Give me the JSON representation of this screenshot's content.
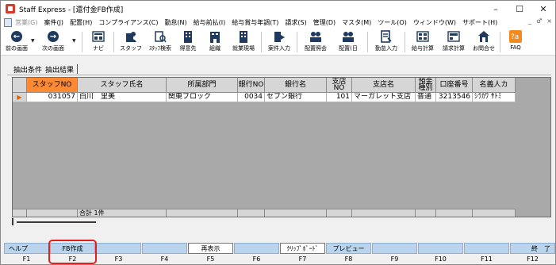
{
  "window": {
    "title": "Staff Express - [還付金FB作成]",
    "controls": [
      "–",
      "☐",
      "✕"
    ],
    "mdi_controls": [
      "_",
      "♂",
      "×"
    ]
  },
  "menu": [
    {
      "label": "営業(G)",
      "disabled": true
    },
    {
      "label": "案件(J)",
      "disabled": false
    },
    {
      "label": "配置(H)",
      "disabled": false
    },
    {
      "label": "コンプライアンス(C)",
      "disabled": false
    },
    {
      "label": "勤怠(N)",
      "disabled": false
    },
    {
      "label": "給与前払(I)",
      "disabled": false
    },
    {
      "label": "給与賞与年調(T)",
      "disabled": false
    },
    {
      "label": "請求(S)",
      "disabled": false
    },
    {
      "label": "管理(D)",
      "disabled": false
    },
    {
      "label": "マスタ(M)",
      "disabled": false
    },
    {
      "label": "ツール(O)",
      "disabled": false
    },
    {
      "label": "ウィンドウ(W)",
      "disabled": false
    },
    {
      "label": "サポート(H)",
      "disabled": false
    }
  ],
  "toolbar": {
    "back": "前の画面",
    "forward": "次の画面",
    "navi": "ナビ",
    "staff": "スタッフ",
    "staff_search": "ｽﾀｯﾌ検索",
    "client": "得意先",
    "org": "組織",
    "site": "就業現場",
    "job_input": "案件入力",
    "assign_inquiry": "配置照会",
    "assign_day": "配置(日",
    "attendance_input": "勤怠入力",
    "payroll_calc": "給与計算",
    "billing_calc": "請求計算",
    "contact": "お問合せ",
    "faq": "FAQ"
  },
  "tabs": {
    "conditions": "抽出条件",
    "results": "抽出結果"
  },
  "grid": {
    "headers": {
      "staff_no": "スタッフNO",
      "staff_name": "スタッフ氏名",
      "dept": "所属部門",
      "bank_no": "銀行NO",
      "bank_name": "銀行名",
      "branch_no": "支店NO",
      "branch_name": "支店名",
      "deposit_type": "預金種別",
      "account_no": "口座番号",
      "holder_name": "名義人カ"
    },
    "row": {
      "staff_no": "031057",
      "staff_name": "白川　里美",
      "dept": "関東ブロック",
      "bank_no": "0034",
      "bank_name": "セブン銀行",
      "branch_no": "101",
      "branch_name": "マーガレット支店",
      "deposit_type": "普通",
      "account_no": "3213546",
      "holder_name": "ｼﾗｶﾜ ｻﾄﾐ"
    },
    "total": "合計 1件"
  },
  "fkeys": [
    {
      "key": "F1",
      "label": "ヘルプ"
    },
    {
      "key": "F2",
      "label": "FB作成"
    },
    {
      "key": "F3",
      "label": ""
    },
    {
      "key": "F4",
      "label": ""
    },
    {
      "key": "F5",
      "label": "再表示"
    },
    {
      "key": "F6",
      "label": ""
    },
    {
      "key": "F7",
      "label": "ｸﾘｯﾌﾟﾎﾞｰﾄﾞ"
    },
    {
      "key": "F8",
      "label": "プレビュー"
    },
    {
      "key": "F9",
      "label": ""
    },
    {
      "key": "F10",
      "label": ""
    },
    {
      "key": "F11",
      "label": ""
    },
    {
      "key": "F12",
      "label": "終　了"
    }
  ]
}
